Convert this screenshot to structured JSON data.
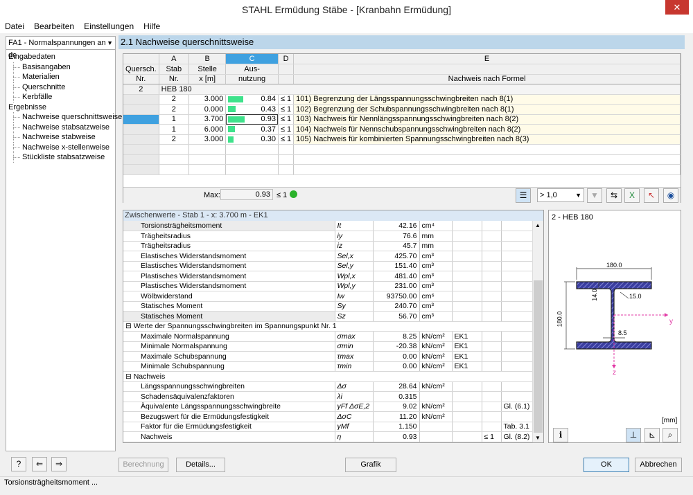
{
  "window": {
    "title": "STAHL Ermüdung Stäbe - [Kranbahn Ermüdung]",
    "close": "✕"
  },
  "menu": [
    "Datei",
    "Bearbeiten",
    "Einstellungen",
    "Hilfe"
  ],
  "nav": {
    "selector": "FA1 - Normalspannungen an de",
    "items": [
      {
        "label": "Eingabedaten",
        "level": 0
      },
      {
        "label": "Basisangaben",
        "level": 1
      },
      {
        "label": "Materialien",
        "level": 1
      },
      {
        "label": "Querschnitte",
        "level": 1
      },
      {
        "label": "Kerbfälle",
        "level": 1
      },
      {
        "label": "Ergebnisse",
        "level": 0
      },
      {
        "label": "Nachweise querschnittsweise",
        "level": 1
      },
      {
        "label": "Nachweise stabsatzweise",
        "level": 1
      },
      {
        "label": "Nachweise stabweise",
        "level": 1
      },
      {
        "label": "Nachweise x-stellenweise",
        "level": 1
      },
      {
        "label": "Stückliste stabsatzweise",
        "level": 1
      }
    ]
  },
  "main": {
    "title": "2.1 Nachweise querschnittsweise",
    "columns": {
      "letters": [
        "A",
        "B",
        "C",
        "D",
        "E"
      ],
      "h0a": "Quersch.",
      "h0b": "Nr.",
      "hA1": "Stab",
      "hA2": "Nr.",
      "hB1": "Stelle",
      "hB2": "x [m]",
      "hC1": "Aus-",
      "hC2": "nutzung",
      "hE": "Nachweis nach Formel"
    },
    "section": {
      "nr": "2",
      "name": "HEB 180"
    },
    "rows": [
      {
        "stab": "2",
        "x": "3.000",
        "ausn": "0.84",
        "fill": 0.84,
        "le": "≤ 1",
        "formula": "101) Begrenzung der Längsspannungsschwingbreiten nach 8(1)"
      },
      {
        "stab": "2",
        "x": "0.000",
        "ausn": "0.43",
        "fill": 0.43,
        "le": "≤ 1",
        "formula": "102) Begrenzung der Schubspannungsschwingbreiten nach 8(1)"
      },
      {
        "stab": "1",
        "x": "3.700",
        "ausn": "0.93",
        "fill": 0.93,
        "le": "≤ 1",
        "formula": "103) Nachweis für Nennlängsspannungsschwingbreiten nach 8(2)"
      },
      {
        "stab": "1",
        "x": "6.000",
        "ausn": "0.37",
        "fill": 0.37,
        "le": "≤ 1",
        "formula": "104) Nachweis für Nennschubspannungsschwingbreiten nach 8(2)"
      },
      {
        "stab": "2",
        "x": "3.000",
        "ausn": "0.30",
        "fill": 0.3,
        "le": "≤ 1",
        "formula": "105) Nachweis für kombinierten Spannungsschwingbreiten nach 8(3)"
      }
    ],
    "max": {
      "label": "Max:",
      "value": "0.93",
      "le": "≤ 1"
    },
    "filter": "> 1,0"
  },
  "zw": {
    "title": "Zwischenwerte  -  Stab 1  -  x: 3.700 m  -  EK1",
    "rows": [
      {
        "t": "r",
        "name": "Torsionsträgheitsmoment",
        "sym": "It",
        "val": "42.16",
        "unit": "cm⁴",
        "ek": "",
        "le": "",
        "ref": ""
      },
      {
        "t": "r",
        "name": "Trägheitsradius",
        "sym": "iy",
        "val": "76.6",
        "unit": "mm",
        "ek": "",
        "le": "",
        "ref": ""
      },
      {
        "t": "r",
        "name": "Trägheitsradius",
        "sym": "iz",
        "val": "45.7",
        "unit": "mm",
        "ek": "",
        "le": "",
        "ref": ""
      },
      {
        "t": "r",
        "name": "Elastisches Widerstandsmoment",
        "sym": "Sel,x",
        "val": "425.70",
        "unit": "cm³",
        "ek": "",
        "le": "",
        "ref": ""
      },
      {
        "t": "r",
        "name": "Elastisches Widerstandsmoment",
        "sym": "Sel,y",
        "val": "151.40",
        "unit": "cm³",
        "ek": "",
        "le": "",
        "ref": ""
      },
      {
        "t": "r",
        "name": "Plastisches Widerstandsmoment",
        "sym": "Wpl,x",
        "val": "481.40",
        "unit": "cm³",
        "ek": "",
        "le": "",
        "ref": ""
      },
      {
        "t": "r",
        "name": "Plastisches Widerstandsmoment",
        "sym": "Wpl,y",
        "val": "231.00",
        "unit": "cm³",
        "ek": "",
        "le": "",
        "ref": ""
      },
      {
        "t": "r",
        "name": "Wölbwiderstand",
        "sym": "Iw",
        "val": "93750.00",
        "unit": "cm⁶",
        "ek": "",
        "le": "",
        "ref": ""
      },
      {
        "t": "r",
        "name": "Statisches Moment",
        "sym": "Sy",
        "val": "240.70",
        "unit": "cm³",
        "ek": "",
        "le": "",
        "ref": ""
      },
      {
        "t": "r",
        "name": "Statisches Moment",
        "sym": "Sz",
        "val": "56.70",
        "unit": "cm³",
        "ek": "",
        "le": "",
        "ref": ""
      },
      {
        "t": "g",
        "name": "⊟ Werte der Spannungsschwingbreiten im Spannungspunkt Nr. 1"
      },
      {
        "t": "r",
        "name": "Maximale Normalspannung",
        "sym": "σmax",
        "val": "8.25",
        "unit": "kN/cm²",
        "ek": "EK1",
        "le": "",
        "ref": ""
      },
      {
        "t": "r",
        "name": "Minimale Normalspannung",
        "sym": "σmin",
        "val": "-20.38",
        "unit": "kN/cm²",
        "ek": "EK1",
        "le": "",
        "ref": ""
      },
      {
        "t": "r",
        "name": "Maximale Schubspannung",
        "sym": "τmax",
        "val": "0.00",
        "unit": "kN/cm²",
        "ek": "EK1",
        "le": "",
        "ref": ""
      },
      {
        "t": "r",
        "name": "Minimale Schubspannung",
        "sym": "τmin",
        "val": "0.00",
        "unit": "kN/cm²",
        "ek": "EK1",
        "le": "",
        "ref": ""
      },
      {
        "t": "g",
        "name": "⊟ Nachweis"
      },
      {
        "t": "r",
        "name": "Längsspannungsschwingbreiten",
        "sym": "Δσ",
        "val": "28.64",
        "unit": "kN/cm²",
        "ek": "",
        "le": "",
        "ref": ""
      },
      {
        "t": "r",
        "name": "Schadensäquivalenzfaktoren",
        "sym": "λi",
        "val": "0.315",
        "unit": "",
        "ek": "",
        "le": "",
        "ref": ""
      },
      {
        "t": "r",
        "name": "Äquivalente Längsspannungsschwingbreite",
        "sym": "γFf ΔσE,2",
        "val": "9.02",
        "unit": "kN/cm²",
        "ek": "",
        "le": "",
        "ref": "Gl. (6.1)"
      },
      {
        "t": "r",
        "name": "Bezugswert für die Ermüdungsfestigkeit",
        "sym": "ΔσC",
        "val": "11.20",
        "unit": "kN/cm²",
        "ek": "",
        "le": "",
        "ref": ""
      },
      {
        "t": "r",
        "name": "Faktor für die Ermüdungsfestigkeit",
        "sym": "γMf",
        "val": "1.150",
        "unit": "",
        "ek": "",
        "le": "",
        "ref": "Tab. 3.1"
      },
      {
        "t": "r",
        "name": "Nachweis",
        "sym": "η",
        "val": "0.93",
        "unit": "",
        "ek": "",
        "le": "≤ 1",
        "ref": "Gl. (8.2)"
      }
    ]
  },
  "xsec": {
    "title": "2 - HEB 180",
    "width": "180.0",
    "height": "180.0",
    "tf": "14.0",
    "r": "15.0",
    "tw": "8.5",
    "y": "y",
    "z": "z",
    "unit": "[mm]"
  },
  "buttons": {
    "calc": "Berechnung",
    "details": "Details...",
    "graphic": "Grafik",
    "ok": "OK",
    "cancel": "Abbrechen"
  },
  "status": "Torsionsträgheitsmoment ..."
}
